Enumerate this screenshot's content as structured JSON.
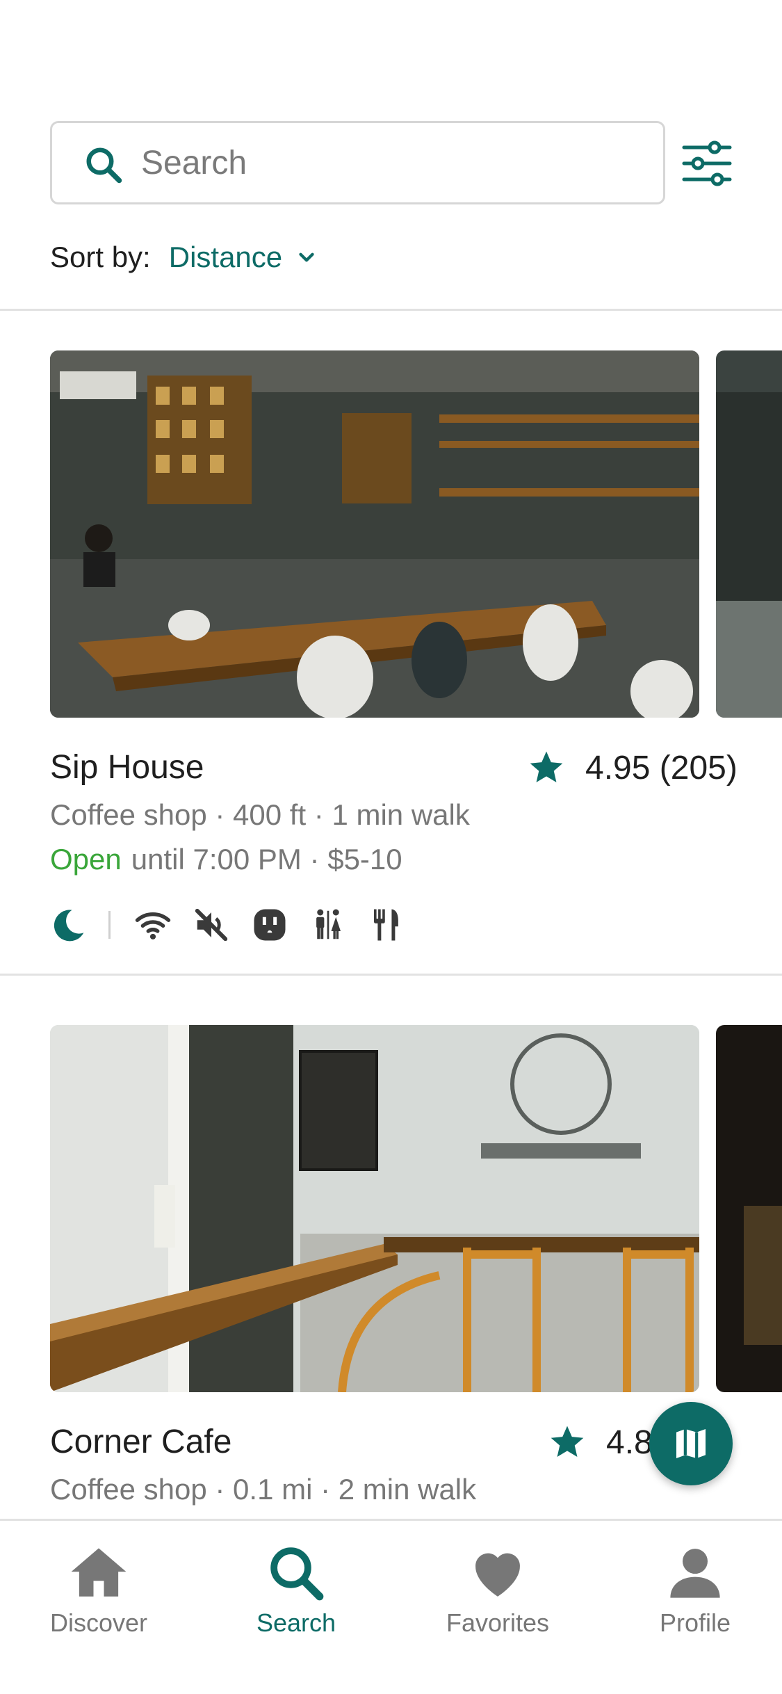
{
  "search": {
    "placeholder": "Search"
  },
  "sort": {
    "label": "Sort by:",
    "value": "Distance"
  },
  "places": [
    {
      "name": "Sip House",
      "rating": "4.95 (205)",
      "meta": "Coffee shop · 400 ft · 1 min walk",
      "status": "Open",
      "hours": "until 7:00 PM · $5-10",
      "amenities": [
        "moon-icon",
        "wifi-icon",
        "no-sound-icon",
        "outlet-icon",
        "restroom-icon",
        "food-icon"
      ]
    },
    {
      "name": "Corner Cafe",
      "rating": "4.8",
      "meta": "Coffee shop · 0.1 mi · 2 min walk"
    }
  ],
  "nav": [
    {
      "label": "Discover",
      "icon": "home-icon"
    },
    {
      "label": "Search",
      "icon": "search-icon",
      "active": true
    },
    {
      "label": "Favorites",
      "icon": "heart-icon"
    },
    {
      "label": "Profile",
      "icon": "person-icon"
    }
  ],
  "colors": {
    "accent": "#0d6b66",
    "open": "#3aa63a",
    "muted": "#777777",
    "text": "#1f1f1f"
  }
}
